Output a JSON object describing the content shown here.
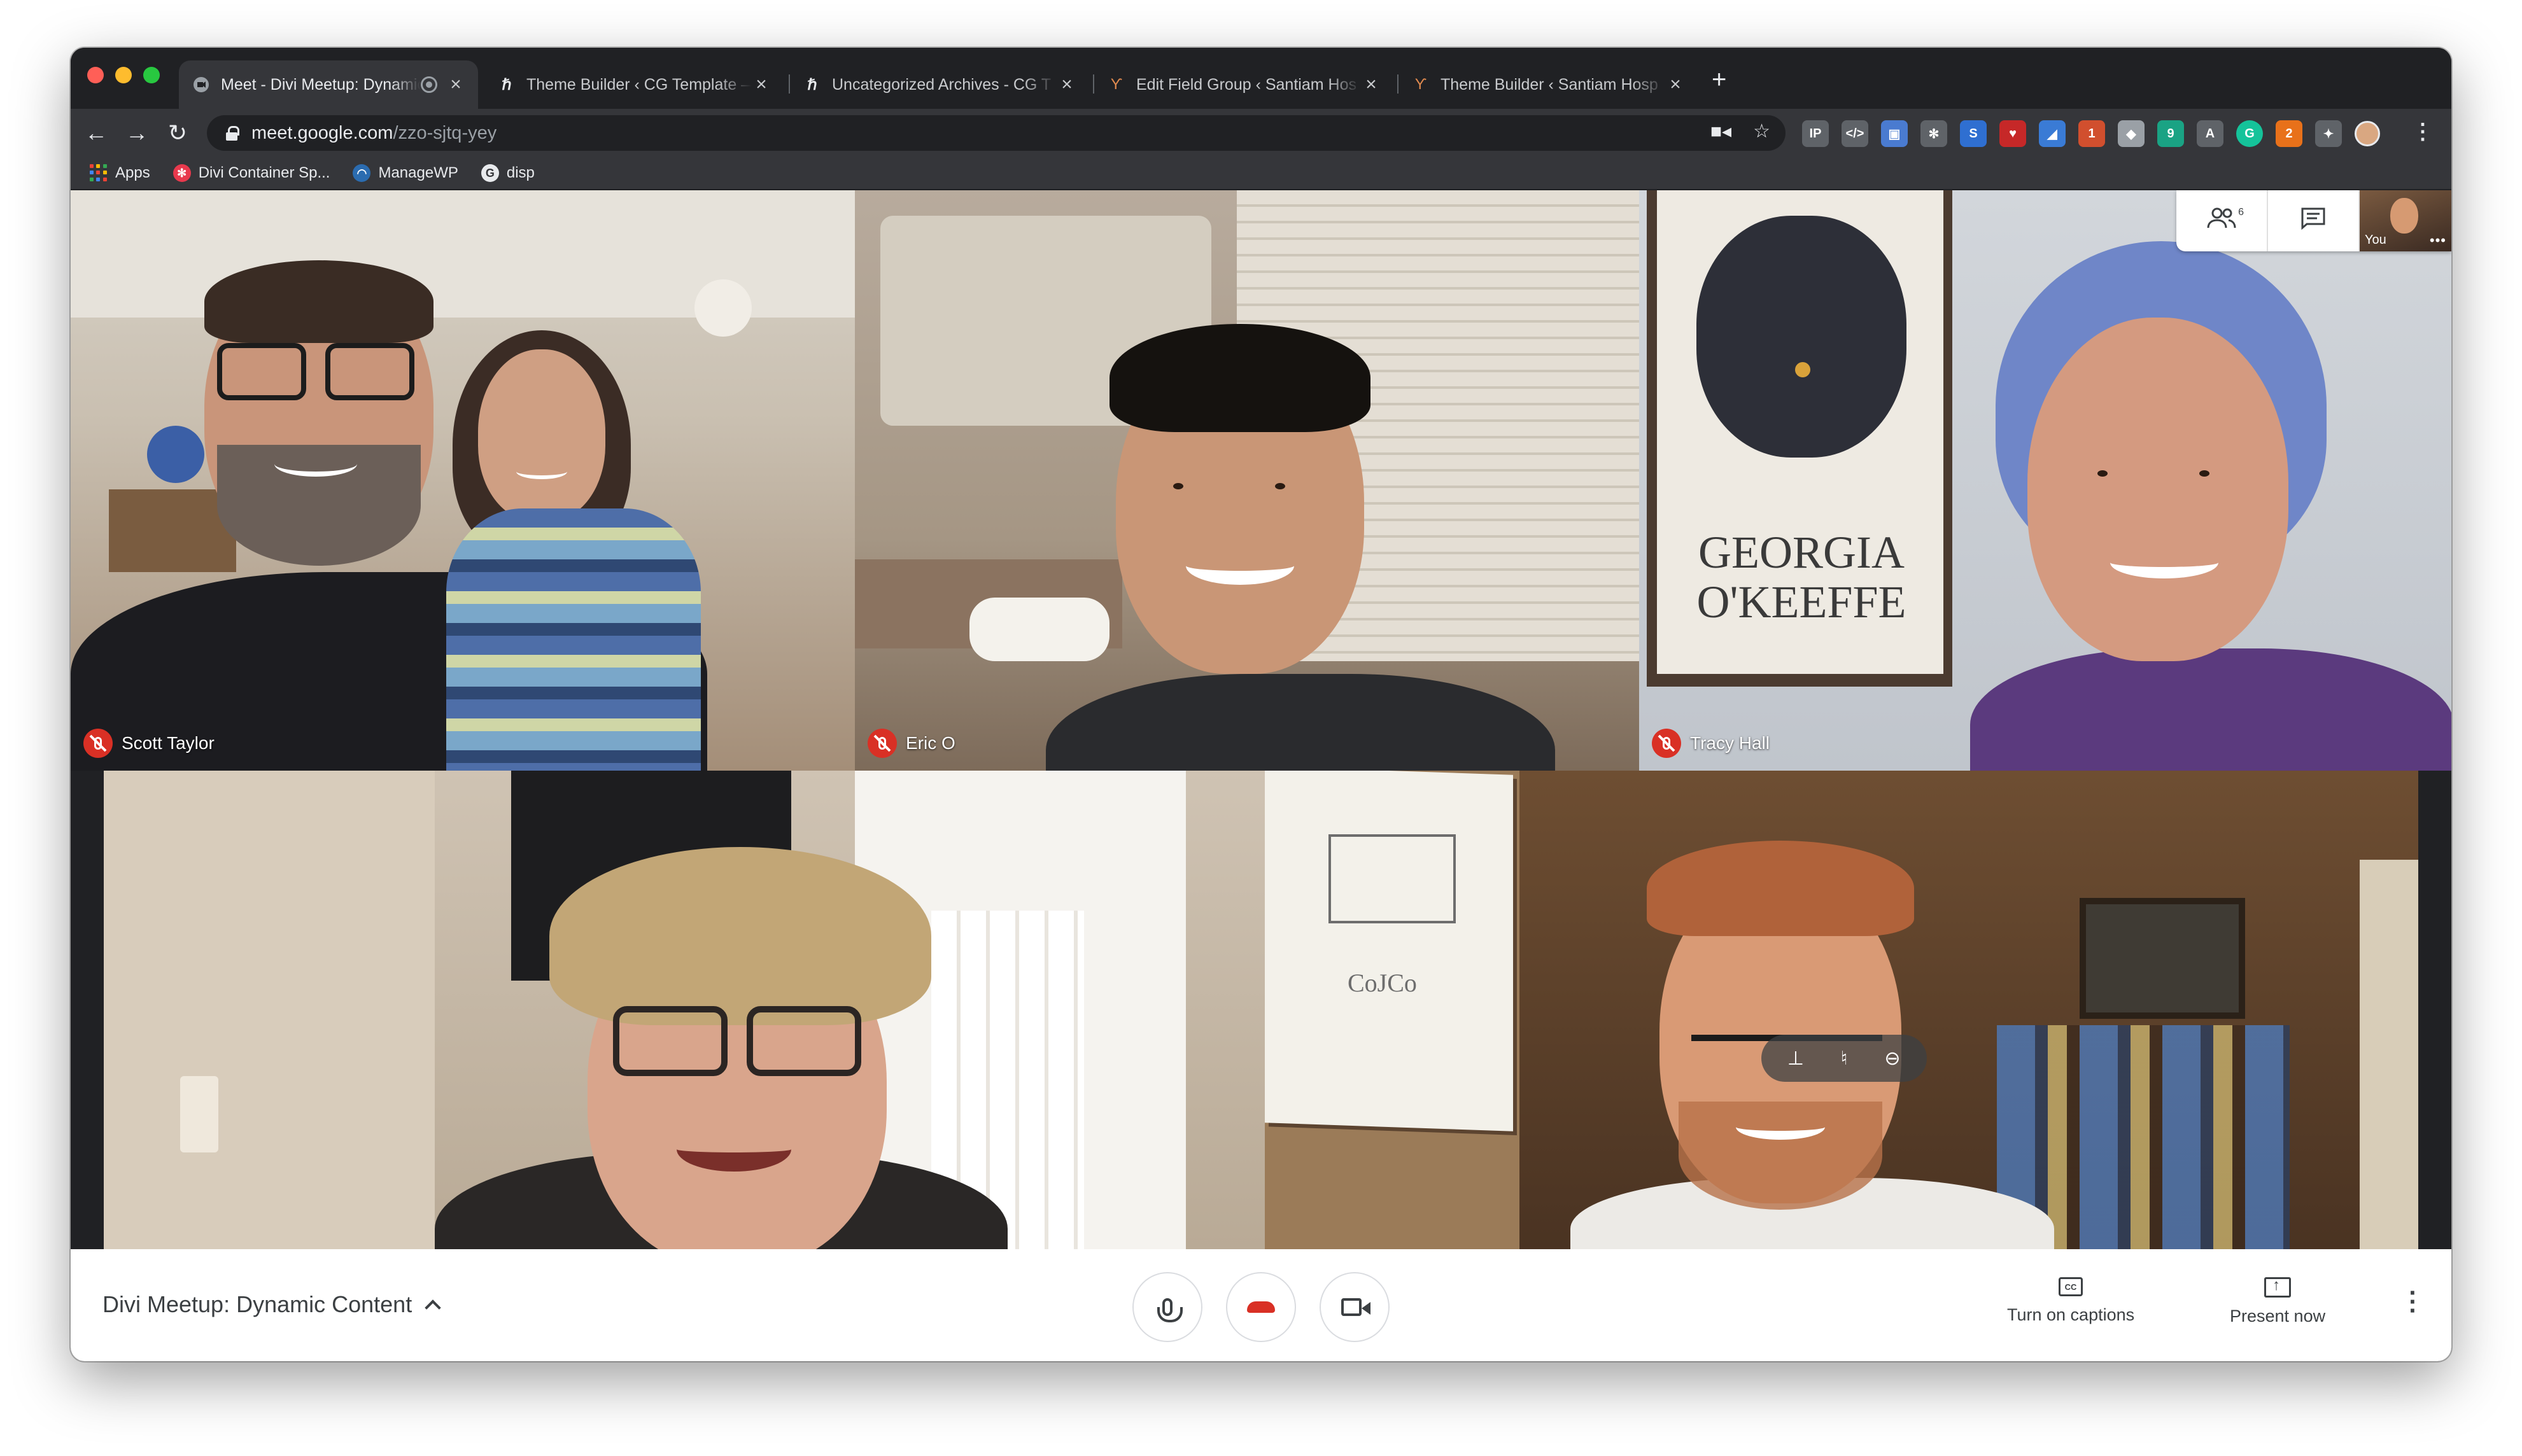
{
  "browser": {
    "tabs": [
      {
        "title": "Meet - Divi Meetup: Dynamic Content",
        "favicon": "meet-icon",
        "active": true
      },
      {
        "title": "Theme Builder ‹ CG Template —",
        "favicon": "builder-icon",
        "active": false
      },
      {
        "title": "Uncategorized Archives - CG T",
        "favicon": "builder-icon",
        "active": false
      },
      {
        "title": "Edit Field Group ‹ Santiam Hos",
        "favicon": "acf-icon",
        "active": false
      },
      {
        "title": "Theme Builder ‹ Santiam Hosp",
        "favicon": "acf-icon",
        "active": false
      }
    ],
    "new_tab": "+",
    "url_host": "meet.google.com",
    "url_path": "/zzo-sjtq-yey",
    "bookmarks": [
      {
        "label": "Apps",
        "icon": "apps-grid-icon"
      },
      {
        "label": "Divi Container Sp...",
        "icon": "divi-icon",
        "color": "#e8394d"
      },
      {
        "label": "ManageWP",
        "icon": "managewp-icon",
        "color": "#2b6cb0"
      },
      {
        "label": "disp",
        "icon": "disp-icon",
        "color": "#e8eaed"
      }
    ],
    "extensions": [
      {
        "label": "IP",
        "color": "#5f6368"
      },
      {
        "label": "</>",
        "color": "#5f6368"
      },
      {
        "label": "▣",
        "color": "#4a7bd0"
      },
      {
        "label": "✻",
        "color": "#5f6368"
      },
      {
        "label": "S",
        "color": "#2f6fd1"
      },
      {
        "label": "♥",
        "color": "#c62828"
      },
      {
        "label": "◢",
        "color": "#3a7bd5"
      },
      {
        "label": "1",
        "color": "#d14f2e"
      },
      {
        "label": "◆",
        "color": "#9aa0a6"
      },
      {
        "label": "9",
        "color": "#1aa384"
      },
      {
        "label": "A",
        "color": "#5f6368"
      },
      {
        "label": "G",
        "color": "#15c39a"
      },
      {
        "label": "2",
        "color": "#e8711a"
      },
      {
        "label": "✦",
        "color": "#5f6368"
      }
    ]
  },
  "meet": {
    "participants": [
      {
        "name": "Scott Taylor",
        "muted": true
      },
      {
        "name": "Eric O",
        "muted": true
      },
      {
        "name": "Tracy Hall",
        "muted": true
      }
    ],
    "people_count": "6",
    "self_label": "You",
    "poster_line1": "GEORGIA",
    "poster_line2": "O'KEEFFE",
    "whiteboard_text": "CoJCo",
    "meeting_title": "Divi Meetup: Dynamic Content",
    "captions_label": "Turn on captions",
    "present_label": "Present now",
    "cc_text": "CC"
  },
  "colors": {
    "mute_red": "#d93025",
    "hangup_red": "#d93025",
    "chrome_dark": "#202124",
    "chrome_toolbar": "#35363a"
  }
}
